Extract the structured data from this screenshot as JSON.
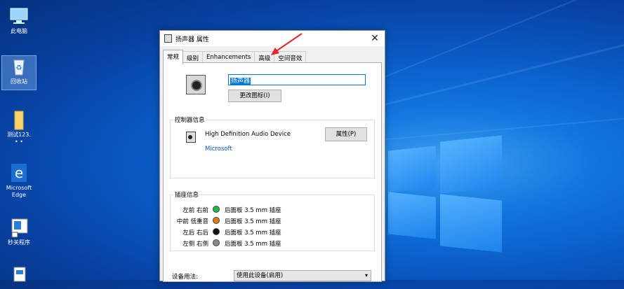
{
  "desktop": {
    "icons": [
      {
        "label": "此电脑"
      },
      {
        "label": "回收站"
      },
      {
        "label": "测试123.",
        "label2": "• •"
      },
      {
        "label": "Microsoft",
        "label2": "Edge"
      },
      {
        "label": "秒关程序"
      }
    ]
  },
  "dialog": {
    "title": "扬声器 属性",
    "close_glyph": "✕",
    "tabs": [
      "常规",
      "级别",
      "Enhancements",
      "高级",
      "空间音效"
    ],
    "device_name": "扬声器",
    "change_icon_label": "更改图标(I)",
    "controller_group": "控制器信息",
    "controller_name": "High Definition Audio Device",
    "controller_vendor": "Microsoft",
    "properties_label": "属性(P)",
    "jack_group": "插座信息",
    "jacks": [
      {
        "label": "左前 右前",
        "color": "#1db84a",
        "desc": "后面板 3.5 mm 插座"
      },
      {
        "label": "中前 低重音",
        "color": "#e07a12",
        "desc": "后面板 3.5 mm 插座"
      },
      {
        "label": "左后 右后",
        "color": "#111111",
        "desc": "后面板 3.5 mm 插座"
      },
      {
        "label": "左侧 右侧",
        "color": "#8a8a8a",
        "desc": "后面板 3.5 mm 插座"
      }
    ],
    "usage_label": "设备用法:",
    "usage_value": "使用此设备(启用)"
  },
  "colors": {
    "accent": "#0078d7",
    "annotation_arrow": "#e8262a"
  }
}
